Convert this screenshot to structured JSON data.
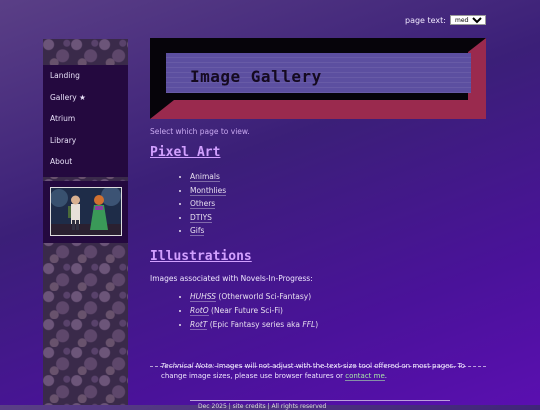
{
  "top": {
    "page_text_label": "page text:",
    "page_text_value": "medium"
  },
  "sidebar": {
    "items": [
      {
        "label": "Landing"
      },
      {
        "label": "Gallery ★"
      },
      {
        "label": "Atrium"
      },
      {
        "label": "Library"
      },
      {
        "label": "About"
      }
    ]
  },
  "banner": {
    "title": "Image Gallery"
  },
  "main": {
    "intro": "Select which page to view.",
    "pixel_art": {
      "heading": "Pixel Art",
      "items": [
        "Animals",
        "Monthlies",
        "Others",
        "DTIYS",
        "Gifs"
      ]
    },
    "illustrations": {
      "heading": "Illustrations",
      "intro": "Images associated with Novels-In-Progress:",
      "items": [
        {
          "link": "HUHSS",
          "desc": "(Otherworld Sci-Fantasy)"
        },
        {
          "link": "RotO",
          "desc": "(Near Future Sci-Fi)"
        },
        {
          "link": "RotT",
          "desc_prefix": "(Epic Fantasy series aka",
          "desc_em": "FFL",
          "desc_suffix": ")"
        }
      ]
    },
    "note": {
      "label": "Technical Note:",
      "text": "Images will not adjust with the text-size tool offered on most pages. To change image sizes, please use browser features or",
      "link": "contact me",
      "end": "."
    },
    "footer": "Dec 2025 | site credits | All rights reserved"
  },
  "colors": {
    "accent": "#d2a0ff",
    "nav_bg": "#24093f",
    "banner_red": "#9a2a4e",
    "link_green": "#a8e8a8"
  }
}
